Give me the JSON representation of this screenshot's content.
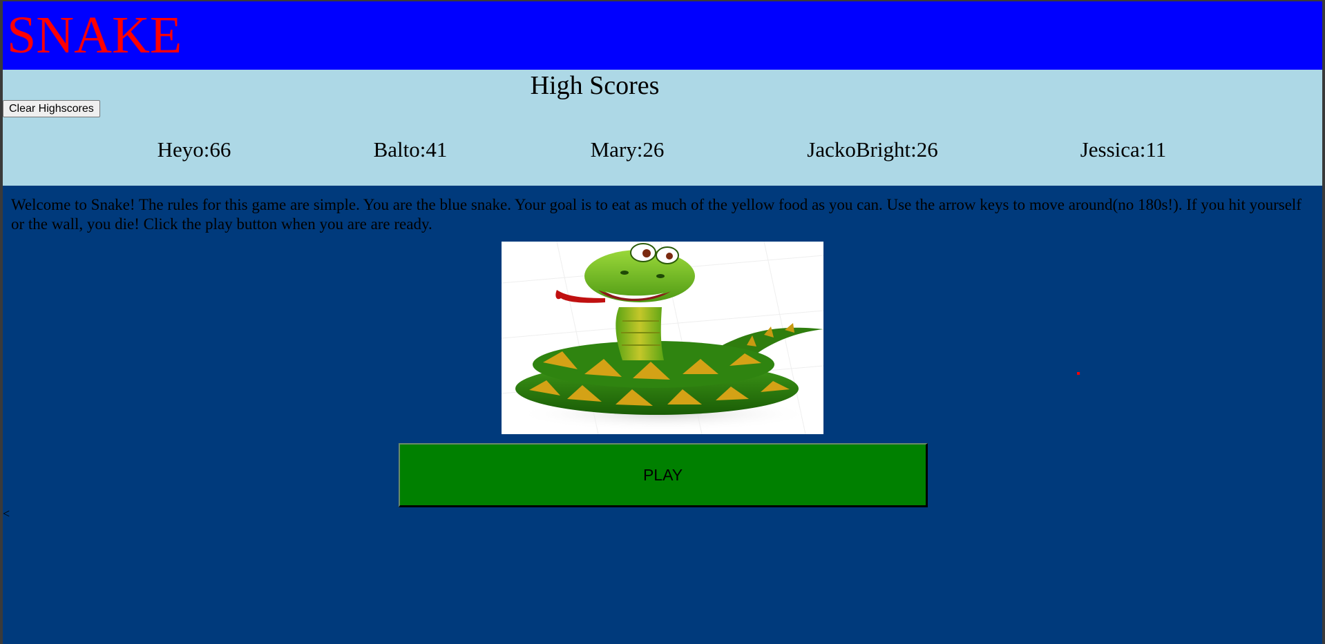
{
  "header": {
    "title": "SNAKE"
  },
  "high_scores": {
    "heading": "High Scores",
    "clear_button_label": "Clear Highscores",
    "entries": [
      {
        "text": "Heyo:66"
      },
      {
        "text": "Balto:41"
      },
      {
        "text": "Mary:26"
      },
      {
        "text": "JackoBright:26"
      },
      {
        "text": "Jessica:11"
      }
    ]
  },
  "main": {
    "rules_text": "Welcome to Snake! The rules for this game are simple. You are the blue snake. Your goal is to eat as much of the yellow food as you can. Use the arrow keys to move around(no 180s!). If you hit yourself or the wall, you die! Click the play button when you are are ready.",
    "image_subject": "cartoon-green-snake",
    "play_button_label": "PLAY",
    "stray_text": "<"
  },
  "colors": {
    "header_background": "#0000ff",
    "title_color": "#ff0000",
    "scores_background": "#add8e6",
    "page_background": "#003a7c",
    "play_button_background": "#008000"
  }
}
